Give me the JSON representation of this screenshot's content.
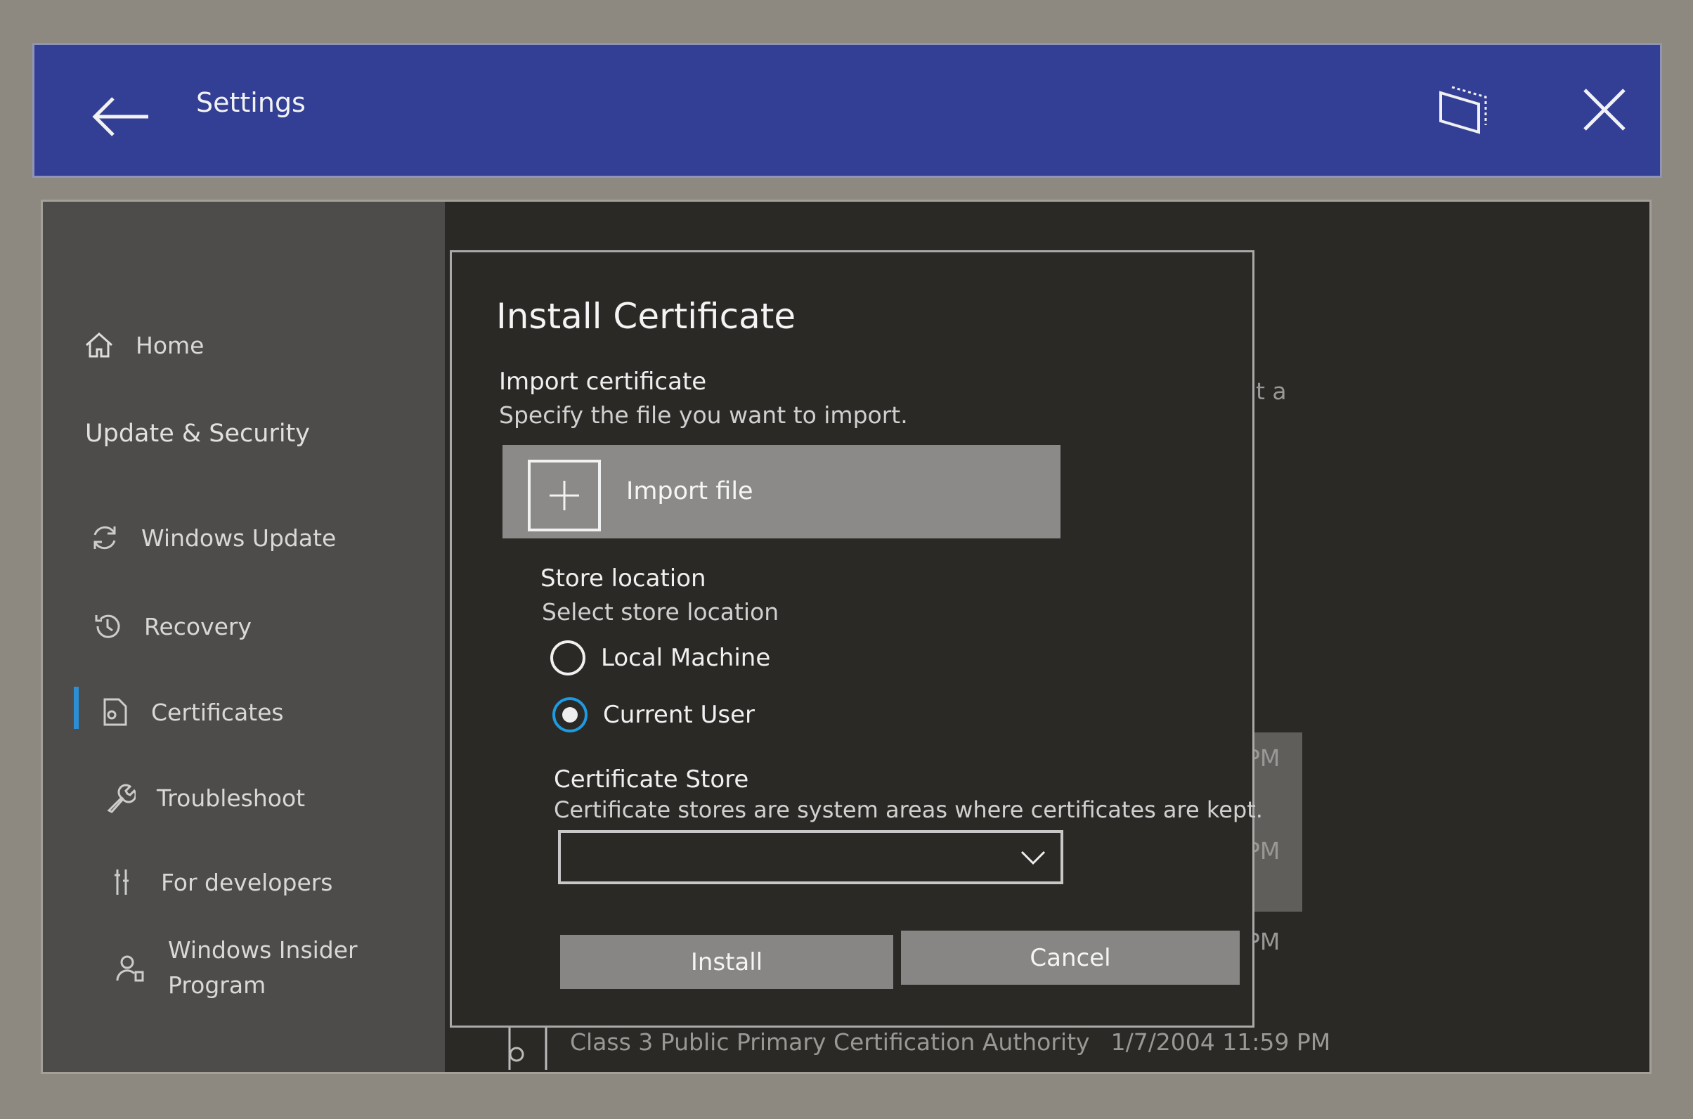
{
  "window": {
    "title": "Settings",
    "back_icon": "arrow-left-icon",
    "snap_icon": "window-snap-icon",
    "close_icon": "close-icon",
    "titlebar_color": "#333f95"
  },
  "sidebar": {
    "home": "Home",
    "section": "Update & Security",
    "items": [
      {
        "label": "Windows Update",
        "icon": "sync-icon"
      },
      {
        "label": "Recovery",
        "icon": "history-icon"
      },
      {
        "label": "Certificates",
        "icon": "certificate-icon",
        "selected": true
      },
      {
        "label": "Troubleshoot",
        "icon": "wrench-icon"
      },
      {
        "label": "For developers",
        "icon": "developer-tools-icon"
      },
      {
        "label": "Windows Insider Program",
        "icon": "insider-icon"
      }
    ],
    "accent_color": "#2a8fd6"
  },
  "dialog": {
    "title": "Install Certificate",
    "import_heading": "Import certificate",
    "import_desc": "Specify the file you want to import.",
    "import_button": "Import file",
    "store_heading": "Store location",
    "store_desc": "Select store location",
    "options": [
      {
        "label": "Local Machine",
        "selected": false
      },
      {
        "label": "Current User",
        "selected": true
      }
    ],
    "cert_store_heading": "Certificate Store",
    "cert_store_desc": "Certificate stores are system areas where certificates are kept.",
    "cert_store_value": "",
    "install": "Install",
    "cancel": "Cancel",
    "radio_color": "#1e9be0"
  },
  "background": {
    "partial_text": "t a",
    "times": [
      "PM",
      "PM",
      "PM"
    ],
    "last_row": {
      "name": "Class 3 Public Primary Certification Authority",
      "date": "1/7/2004 11:59 PM"
    }
  }
}
